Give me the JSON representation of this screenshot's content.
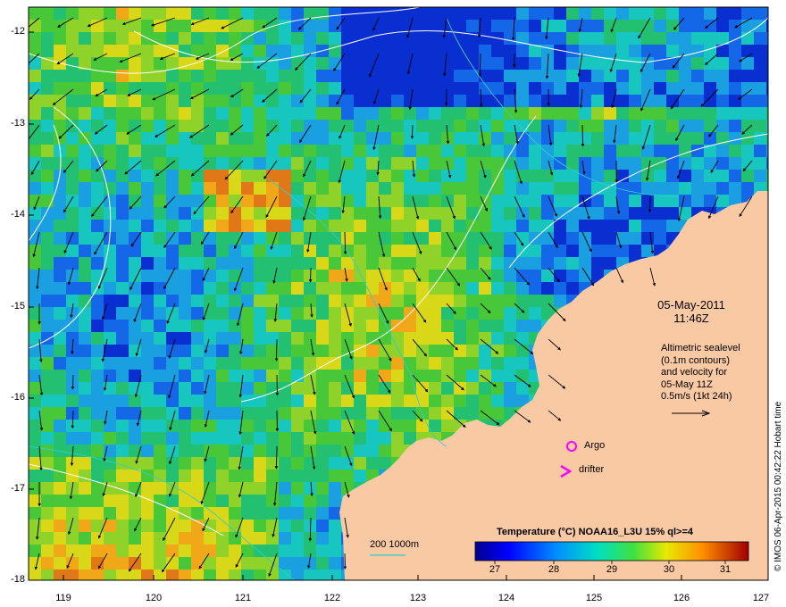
{
  "map": {
    "lat_ticks": [
      "-12",
      "-13",
      "-14",
      "-15",
      "-16",
      "-17",
      "-18"
    ],
    "lon_ticks": [
      "119",
      "120",
      "121",
      "122",
      "123",
      "124",
      "125",
      "126",
      "127"
    ],
    "date": "05-May-2011",
    "time": "11:46Z",
    "info_lines": [
      "Altimetric sealevel",
      "(0.1m contours)",
      "and velocity for",
      "05-May 11Z",
      "0.5m/s (1kt 24h)"
    ],
    "argo_label": "Argo",
    "drifter_label": "drifter",
    "depth_label": "200  1000m",
    "colorbar_title": "Temperature (°C) NOAA16_L3U 15% ql>=4",
    "colorbar_ticks": [
      "27",
      "28",
      "29",
      "30",
      "31"
    ],
    "credit": "© IMOS 06-Apr-2015 00:42:22 Hobart time",
    "colors": {
      "land": "#f9c9a4",
      "marker": "#ff00ff",
      "depth_line": "#33cccc",
      "contour": "#ffffff"
    }
  }
}
